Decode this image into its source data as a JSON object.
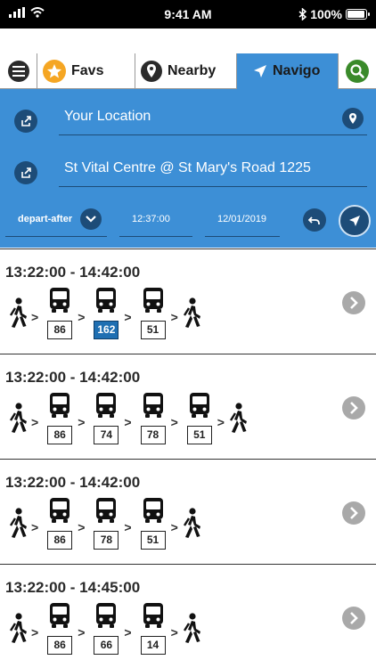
{
  "status_bar": {
    "time": "9:41 AM",
    "battery": "100%",
    "battery_level": 1.0
  },
  "tabs": {
    "favs": "Favs",
    "nearby": "Nearby",
    "navigo": "Navigo",
    "active": "navigo"
  },
  "search": {
    "origin": "Your Location",
    "destination": "St Vital Centre @ St Mary's Road 1225",
    "mode": "depart-after",
    "time": "12:37:00",
    "date": "12/01/2019"
  },
  "colors": {
    "accent": "#3d8fd6",
    "dark_button": "#1d4c78",
    "search_green": "#3a8a2a",
    "highlight_route": "#1f6fb2"
  },
  "trips": [
    {
      "time": "13:22:00 - 14:42:00",
      "routes": [
        "86",
        "162",
        "51"
      ],
      "highlighted": "162"
    },
    {
      "time": "13:22:00 - 14:42:00",
      "routes": [
        "86",
        "74",
        "78",
        "51"
      ],
      "highlighted": ""
    },
    {
      "time": "13:22:00 - 14:42:00",
      "routes": [
        "86",
        "78",
        "51"
      ],
      "highlighted": ""
    },
    {
      "time": "13:22:00 - 14:45:00",
      "routes": [
        "86",
        "66",
        "14"
      ],
      "highlighted": ""
    }
  ],
  "icons": [
    "menu-icon",
    "star-icon",
    "map-pin-icon",
    "navigation-arrow-icon",
    "search-icon",
    "share-icon",
    "chevron-down-icon",
    "undo-icon",
    "walk-icon",
    "bus-icon",
    "chevron-right-icon"
  ]
}
